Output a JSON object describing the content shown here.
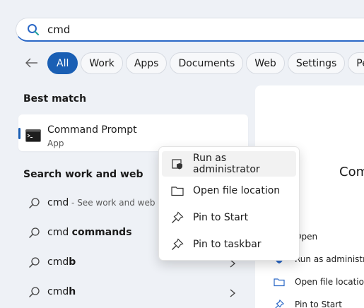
{
  "search": {
    "value": "cmd"
  },
  "filters": [
    {
      "label": "All",
      "active": true
    },
    {
      "label": "Work"
    },
    {
      "label": "Apps"
    },
    {
      "label": "Documents"
    },
    {
      "label": "Web"
    },
    {
      "label": "Settings"
    },
    {
      "label": "People"
    }
  ],
  "left": {
    "best_match_title": "Best match",
    "best_match": {
      "name": "Command Prompt",
      "type": "App"
    },
    "search_web_title": "Search work and web",
    "web_results": [
      {
        "prefix": "cmd",
        "bold": "",
        "hint": " - See work and web results"
      },
      {
        "prefix": "cmd ",
        "bold": "commands",
        "hint": ""
      },
      {
        "prefix": "cmd",
        "bold": "b",
        "hint": ""
      },
      {
        "prefix": "cmd",
        "bold": "h",
        "hint": ""
      }
    ]
  },
  "right": {
    "title": "Command Prompt",
    "actions": [
      {
        "label": "Open",
        "icon": "open-icon"
      },
      {
        "label": "Run as administrator",
        "icon": "shield-icon"
      },
      {
        "label": "Open file location",
        "icon": "folder-icon"
      },
      {
        "label": "Pin to Start",
        "icon": "pin-icon"
      }
    ]
  },
  "context_menu": [
    {
      "label": "Run as administrator",
      "icon": "shield-icon"
    },
    {
      "label": "Open file location",
      "icon": "folder-icon"
    },
    {
      "label": "Pin to Start",
      "icon": "pin-icon"
    },
    {
      "label": "Pin to taskbar",
      "icon": "pin-icon"
    }
  ],
  "colors": {
    "accent": "#1a5fb4",
    "background": "#eef1f6"
  }
}
